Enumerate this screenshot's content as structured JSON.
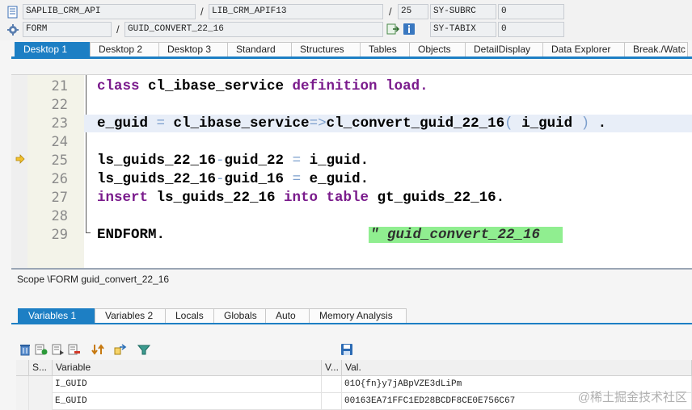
{
  "infobar": {
    "row1": {
      "program": "SAPLIB_CRM_API",
      "include": "LIB_CRM_APIF13",
      "line": "25",
      "sysfield_label": "SY-SUBRC",
      "sysfield_value": "0"
    },
    "row2": {
      "type": "FORM",
      "name": "GUID_CONVERT_22_16",
      "sysfield_label": "SY-TABIX",
      "sysfield_value": "0"
    },
    "separator": "/"
  },
  "desktop_tabs": [
    "Desktop 1",
    "Desktop 2",
    "Desktop 3",
    "Standard",
    "Structures",
    "Tables",
    "Objects",
    "DetailDisplay",
    "Data Explorer",
    "Break./Watc"
  ],
  "editor": {
    "lines": [
      {
        "num": "21"
      },
      {
        "num": "22"
      },
      {
        "num": "23"
      },
      {
        "num": "24"
      },
      {
        "num": "25"
      },
      {
        "num": "26"
      },
      {
        "num": "27"
      },
      {
        "num": "28"
      },
      {
        "num": "29"
      }
    ],
    "code": {
      "l21_kw1": "class",
      "l21_id": " cl_ibase_service ",
      "l21_kw2": "definition load",
      "l21_end": ".",
      "l23_a": "e_guid ",
      "l23_eq": "=",
      "l23_b": " cl_ibase_service",
      "l23_arrow": "=>",
      "l23_c": "cl_convert_guid_22_16",
      "l23_p1": "(",
      "l23_d": " i_guid ",
      "l23_p2": ")",
      "l23_e": " .",
      "l25_a": "ls_guids_22_16",
      "l25_dash": "-",
      "l25_b": "guid_22 ",
      "l25_eq": "=",
      "l25_c": " i_guid.",
      "l26_a": "ls_guids_22_16",
      "l26_dash": "-",
      "l26_b": "guid_16 ",
      "l26_eq": "=",
      "l26_c": " e_guid.",
      "l27_kw1": "insert",
      "l27_a": " ls_guids_22_16 ",
      "l27_kw2": "into table",
      "l27_b": " gt_guids_22_16.",
      "l29_a": "ENDFORM.",
      "l29_cmt": "\" guid_convert_22_16"
    }
  },
  "scope": "Scope \\FORM guid_convert_22_16",
  "lower_tabs": [
    "Variables 1",
    "Variables 2",
    "Locals",
    "Globals",
    "Auto",
    "Memory Analysis"
  ],
  "variables": {
    "headers": {
      "sel": "S...",
      "variable": "Variable",
      "v": "V...",
      "value": "Val."
    },
    "rows": [
      {
        "variable": "I_GUID",
        "value": "01O{fn}y7jABpVZE3dLiPm"
      },
      {
        "variable": "E_GUID",
        "value": "00163EA71FFC1ED28BCDF8CE0E756C67"
      }
    ]
  },
  "watermark": "@稀土掘金技术社区"
}
